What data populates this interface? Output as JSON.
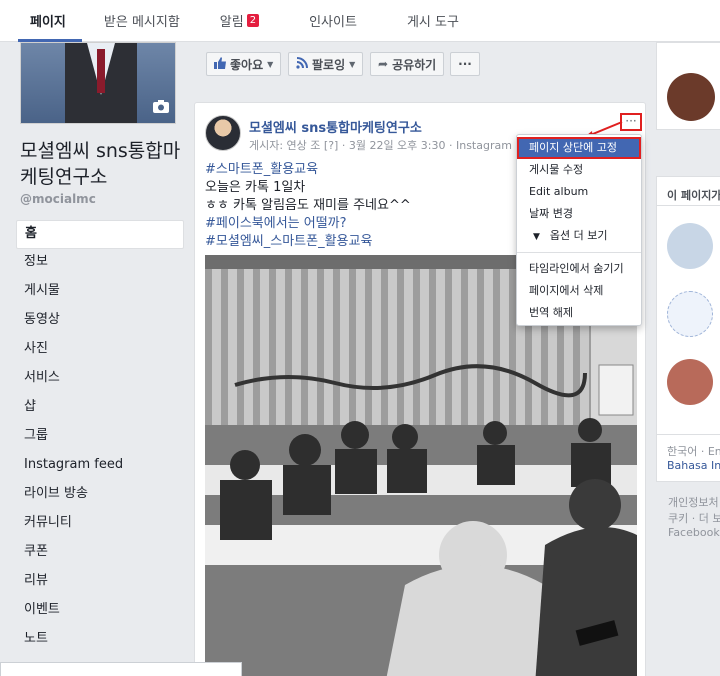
{
  "topnav": {
    "tabs": [
      {
        "label": "페이지"
      },
      {
        "label": "받은 메시지함"
      },
      {
        "label": "알림",
        "badge": "2"
      },
      {
        "label": "인사이트"
      },
      {
        "label": "게시 도구"
      }
    ]
  },
  "page": {
    "name": "모셜엠씨 sns통합마케팅연구소",
    "handle": "@mocialmc"
  },
  "leftnav": {
    "items": [
      {
        "label": "홈"
      },
      {
        "label": "정보"
      },
      {
        "label": "게시물"
      },
      {
        "label": "동영상"
      },
      {
        "label": "사진"
      },
      {
        "label": "서비스"
      },
      {
        "label": "샵"
      },
      {
        "label": "그룹"
      },
      {
        "label": "Instagram feed"
      },
      {
        "label": "라이브 방송"
      },
      {
        "label": "커뮤니티"
      },
      {
        "label": "쿠폰"
      },
      {
        "label": "리뷰"
      },
      {
        "label": "이벤트"
      },
      {
        "label": "노트"
      }
    ]
  },
  "actionbar": {
    "like": "좋아요",
    "follow": "팔로잉",
    "share": "공유하기",
    "more": "···"
  },
  "post": {
    "author": "모셜엠씨 sns통합마케팅연구소",
    "meta": "게시자: 연상 조 [?] · 3월 22일 오후 3:30 · Instagram ·",
    "lines": [
      {
        "text": "#스마트폰_활용교육",
        "tag": true
      },
      {
        "text": "오늘은 카톡 1일차",
        "tag": false
      },
      {
        "text": "ㅎㅎ 카톡 알림음도 재미를 주네요^^",
        "tag": false
      },
      {
        "text": "#페이스북에서는 어떨까?",
        "tag": true
      },
      {
        "text": "#모셜엠씨_스마트폰_활용교육",
        "tag": true
      }
    ],
    "more_button": "···"
  },
  "dropdown": {
    "items": [
      "페이지 상단에 고정",
      "게시물 수정",
      "Edit album",
      "날짜 변경",
      "옵션 더 보기",
      "타임라인에서 숨기기",
      "페이지에서 삭제",
      "번역 해제"
    ]
  },
  "rightcol": {
    "related_title": "이 페이지가",
    "lang1": "한국어 · En",
    "lang2": "Bahasa Ind",
    "footer1": "개인정보처",
    "footer2": "쿠키 · 더 보",
    "footer3": "Facebook ©"
  },
  "colors": {
    "brand": "#4267b2",
    "link": "#365899",
    "highlight_border": "#e02020"
  }
}
